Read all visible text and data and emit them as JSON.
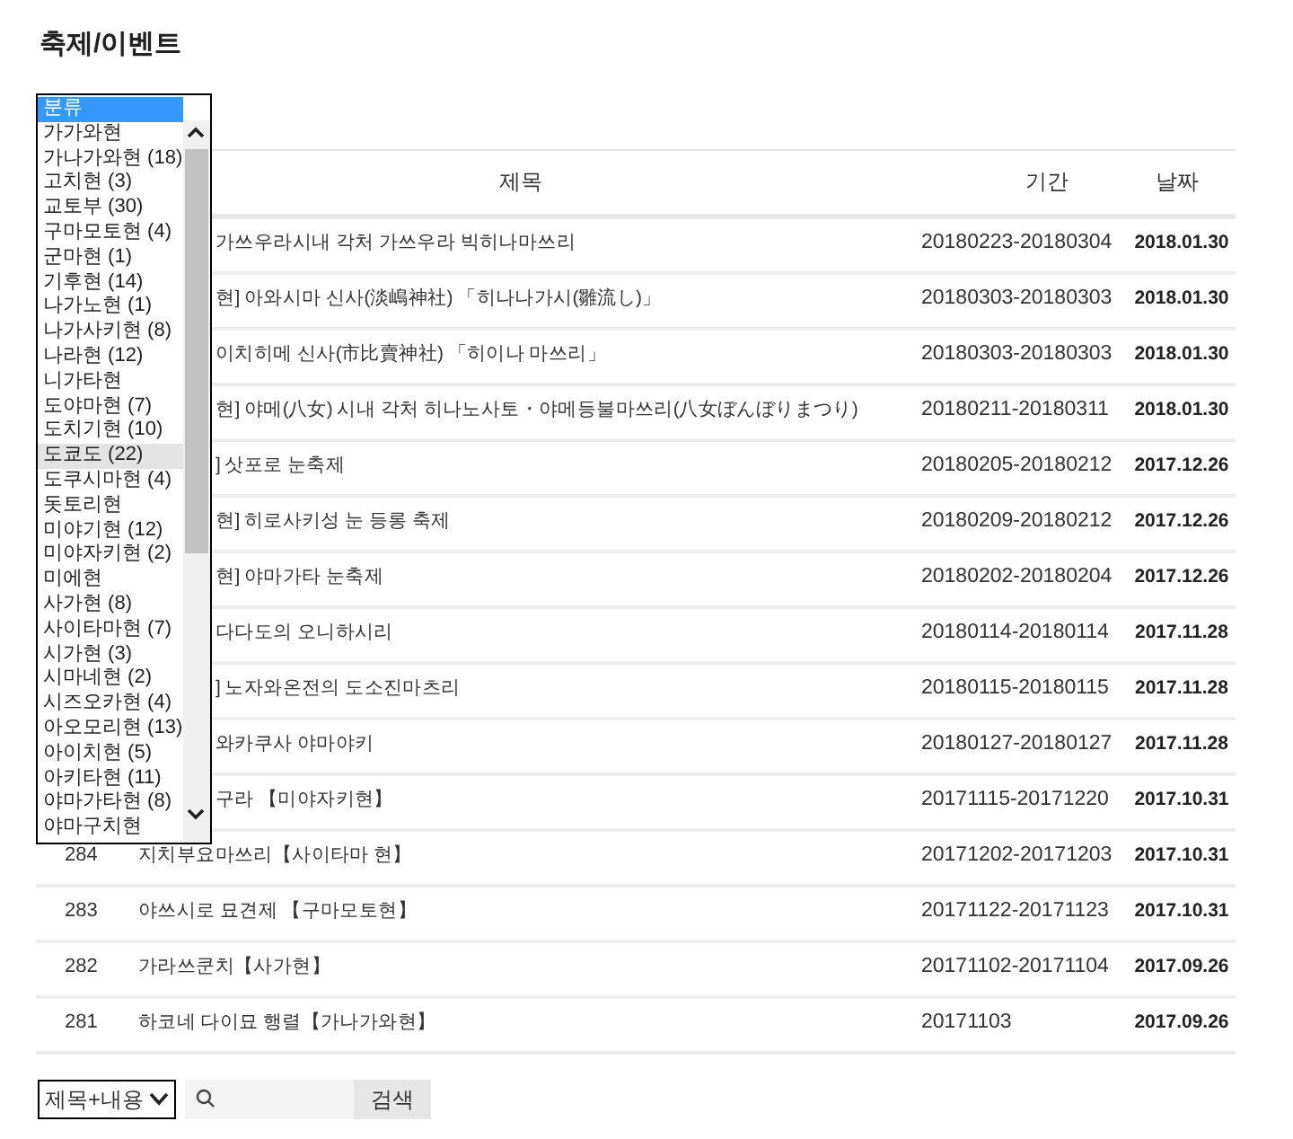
{
  "page_title": "축제/이벤트",
  "category_dropdown": {
    "items": [
      {
        "label": "분류",
        "selected": true,
        "hovered": false
      },
      {
        "label": "가가와현",
        "selected": false,
        "hovered": false
      },
      {
        "label": "가나가와현 (18)",
        "selected": false,
        "hovered": false
      },
      {
        "label": "고치현 (3)",
        "selected": false,
        "hovered": false
      },
      {
        "label": "교토부 (30)",
        "selected": false,
        "hovered": false
      },
      {
        "label": "구마모토현 (4)",
        "selected": false,
        "hovered": false
      },
      {
        "label": "군마현 (1)",
        "selected": false,
        "hovered": false
      },
      {
        "label": "기후현 (14)",
        "selected": false,
        "hovered": false
      },
      {
        "label": "나가노현 (1)",
        "selected": false,
        "hovered": false
      },
      {
        "label": "나가사키현 (8)",
        "selected": false,
        "hovered": false
      },
      {
        "label": "나라현 (12)",
        "selected": false,
        "hovered": false
      },
      {
        "label": "니가타현",
        "selected": false,
        "hovered": false
      },
      {
        "label": "도야마현 (7)",
        "selected": false,
        "hovered": false
      },
      {
        "label": "도치기현 (10)",
        "selected": false,
        "hovered": false
      },
      {
        "label": "도쿄도 (22)",
        "selected": false,
        "hovered": true
      },
      {
        "label": "도쿠시마현 (4)",
        "selected": false,
        "hovered": false
      },
      {
        "label": "돗토리현",
        "selected": false,
        "hovered": false
      },
      {
        "label": "미야기현 (12)",
        "selected": false,
        "hovered": false
      },
      {
        "label": "미야자키현 (2)",
        "selected": false,
        "hovered": false
      },
      {
        "label": "미에현",
        "selected": false,
        "hovered": false
      },
      {
        "label": "사가현 (8)",
        "selected": false,
        "hovered": false
      },
      {
        "label": "사이타마현 (7)",
        "selected": false,
        "hovered": false
      },
      {
        "label": "시가현 (3)",
        "selected": false,
        "hovered": false
      },
      {
        "label": "시마네현 (2)",
        "selected": false,
        "hovered": false
      },
      {
        "label": "시즈오카현 (4)",
        "selected": false,
        "hovered": false
      },
      {
        "label": "아오모리현 (13)",
        "selected": false,
        "hovered": false
      },
      {
        "label": "아이치현 (5)",
        "selected": false,
        "hovered": false
      },
      {
        "label": "아키타현 (11)",
        "selected": false,
        "hovered": false
      },
      {
        "label": "야마가타현 (8)",
        "selected": false,
        "hovered": false
      },
      {
        "label": "야마구치현",
        "selected": false,
        "hovered": false
      }
    ]
  },
  "table": {
    "columns": [
      "제목",
      "기간",
      "날짜"
    ],
    "rows": [
      {
        "title": "가쓰우라시내 각처 가쓰우라 빅히나마쓰리",
        "period": "20180223-20180304",
        "date": "2018.01.30"
      },
      {
        "title": "현]  아와시마 신사(淡嶋神社) 「히나나가시(雛流し)」",
        "period": "20180303-20180303",
        "date": "2018.01.30"
      },
      {
        "title": "이치히메 신사(市比賣神社) 「히이나 마쓰리」",
        "period": "20180303-20180303",
        "date": "2018.01.30"
      },
      {
        "title": "현]  야메(八女) 시내 각처 히나노사토・야메등불마쓰리(八女ぼんぼりまつり)",
        "period": "20180211-20180311",
        "date": "2018.01.30"
      },
      {
        "title": "] 삿포로 눈축제",
        "period": "20180205-20180212",
        "date": "2017.12.26"
      },
      {
        "title": "현] 히로사키성 눈 등롱 축제",
        "period": "20180209-20180212",
        "date": "2017.12.26"
      },
      {
        "title": "현] 야마가타 눈축제",
        "period": "20180202-20180204",
        "date": "2017.12.26"
      },
      {
        "title": "다다도의 오니하시리",
        "period": "20180114-20180114",
        "date": "2017.11.28"
      },
      {
        "title": "] 노자와온전의 도소진마츠리",
        "period": "20180115-20180115",
        "date": "2017.11.28"
      },
      {
        "title": "와카쿠사 야마야키",
        "period": "20180127-20180127",
        "date": "2017.11.28"
      },
      {
        "title": "구라 【미야자키현】",
        "period": "20171115-20171220",
        "date": "2017.10.31"
      },
      {
        "no": "284",
        "title": "지치부요마쓰리【사이타마 현】",
        "period": "20171202-20171203",
        "date": "2017.10.31"
      },
      {
        "no": "283",
        "title": "야쓰시로 묘견제 【구마모토현】",
        "period": "20171122-20171123",
        "date": "2017.10.31"
      },
      {
        "no": "282",
        "title": "가라쓰쿤치【사가현】",
        "period": "20171102-20171104",
        "date": "2017.09.26"
      },
      {
        "no": "281",
        "title": "하코네 다이묘 행렬【가나가와현】",
        "period": "20171103",
        "date": "2017.09.26"
      }
    ]
  },
  "search": {
    "scope": "제목+내용",
    "button": "검색"
  }
}
